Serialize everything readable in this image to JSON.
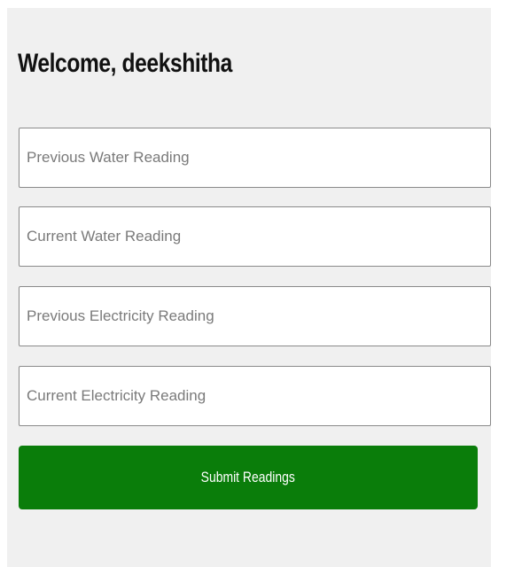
{
  "header": {
    "title": "Welcome, deekshitha"
  },
  "form": {
    "fields": [
      {
        "placeholder": "Previous Water Reading",
        "value": ""
      },
      {
        "placeholder": "Current Water Reading",
        "value": ""
      },
      {
        "placeholder": "Previous Electricity Reading",
        "value": ""
      },
      {
        "placeholder": "Current Electricity Reading",
        "value": ""
      }
    ],
    "submit_label": "Submit Readings"
  },
  "colors": {
    "background": "#f0f0f0",
    "button": "#0a7d0a",
    "button_text": "#ffffff"
  }
}
